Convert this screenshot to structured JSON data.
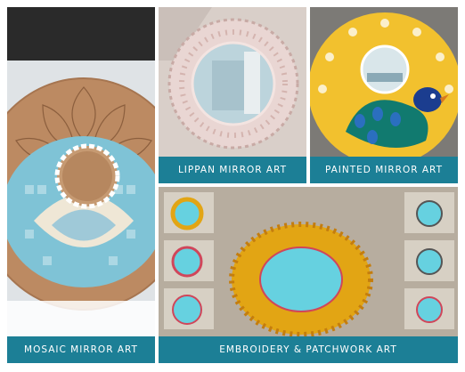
{
  "panels": {
    "mosaic": {
      "caption": "MOSAIC MIRROR ART"
    },
    "lippan": {
      "caption": "LIPPAN MIRROR ART"
    },
    "painted": {
      "caption": "PAINTED MIRROR ART"
    },
    "embroidery": {
      "caption": "EMBROIDERY & PATCHWORK  ART"
    }
  },
  "colors": {
    "caption_bar": "#1c7f96",
    "caption_text": "#ffffff",
    "mosaic_tile": "#7fc3d6",
    "painted_yellow": "#f2c12e",
    "embroidery_thread": "#e2a514",
    "mirror_cyan": "#66d1e0"
  }
}
